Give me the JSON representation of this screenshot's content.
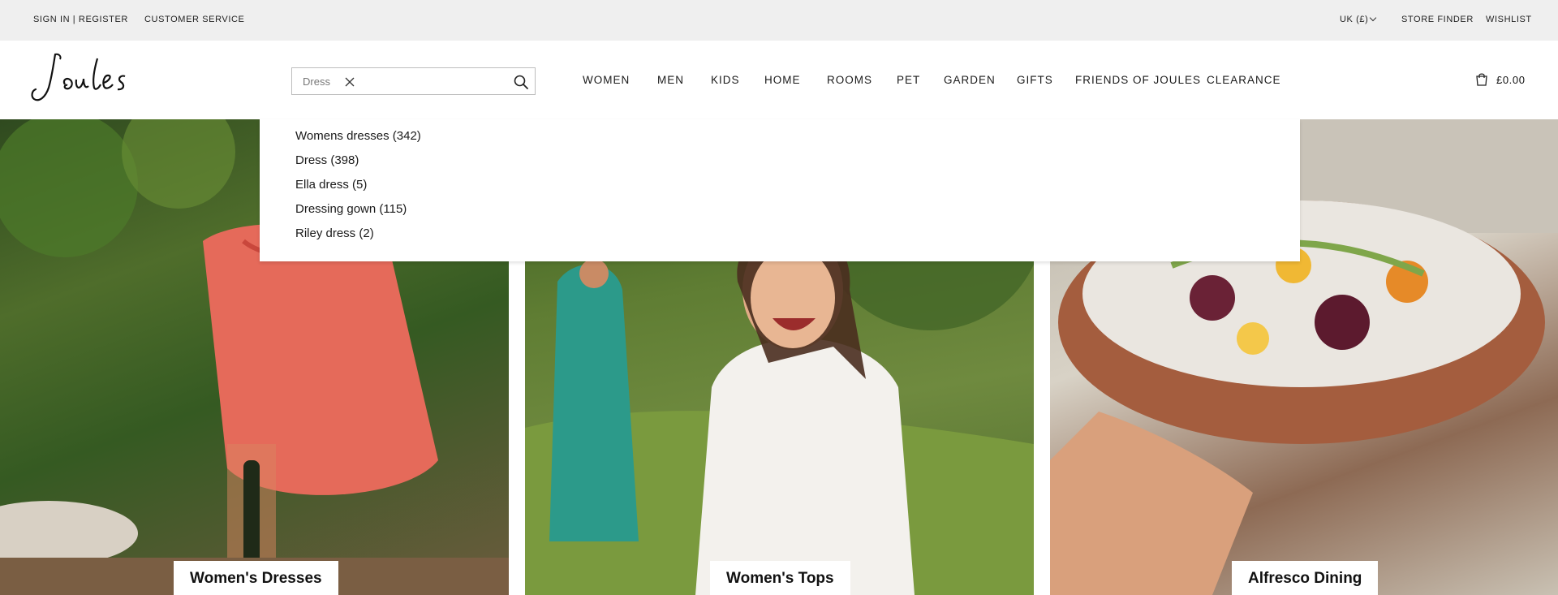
{
  "utility": {
    "sign_in": "SIGN IN | REGISTER",
    "customer_service": "CUSTOMER SERVICE",
    "currency": "UK (£)",
    "store_finder": "STORE FINDER",
    "wishlist": "WISHLIST"
  },
  "brand": {
    "logo_text": "Joules"
  },
  "search": {
    "value": "Dress"
  },
  "nav": [
    "WOMEN",
    "MEN",
    "KIDS",
    "HOME",
    "ROOMS",
    "PET",
    "GARDEN",
    "GIFTS",
    "FRIENDS OF JOULES",
    "CLEARANCE"
  ],
  "basket": {
    "amount": "£0.00"
  },
  "suggestions": [
    "Womens dresses (342)",
    "Dress (398)",
    "Ella dress (5)",
    "Dressing gown (115)",
    "Riley dress (2)"
  ],
  "tiles": [
    "Women's Dresses",
    "Women's Tops",
    "Alfresco Dining"
  ],
  "icons": {
    "clear": "close-icon",
    "search": "search-icon",
    "basket": "shopping-bag-icon",
    "dropdown": "chevron-down-icon"
  }
}
